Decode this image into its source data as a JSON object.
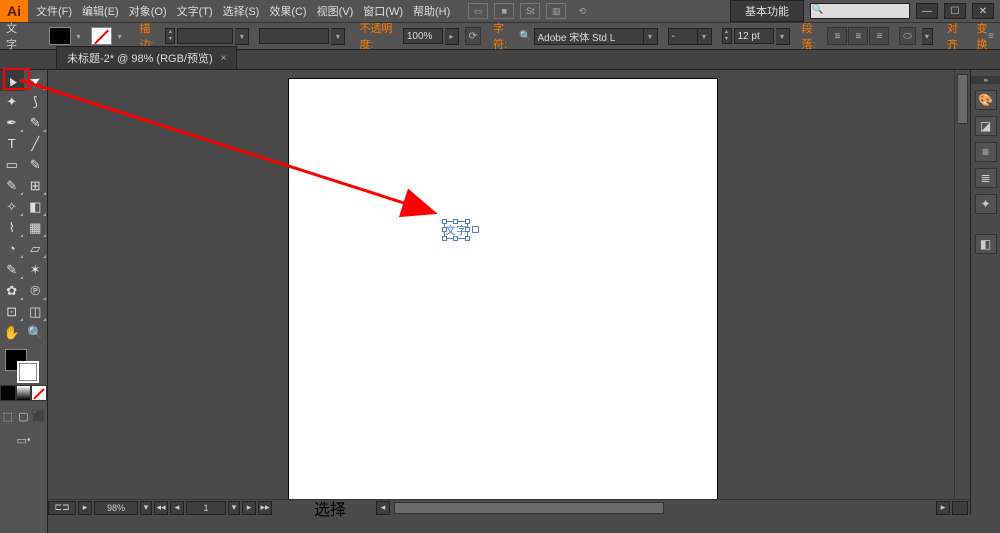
{
  "app": {
    "icon_text": "Ai"
  },
  "menu": {
    "file": "文件(F)",
    "edit": "编辑(E)",
    "object": "对象(O)",
    "type": "文字(T)",
    "select": "选择(S)",
    "effect": "效果(C)",
    "view": "视图(V)",
    "window": "窗口(W)",
    "help": "帮助(H)"
  },
  "menubar_icons": {
    "a": "▭",
    "b": "■",
    "c": "St",
    "d": "▥",
    "e": "⟲"
  },
  "workspace": {
    "label": "基本功能",
    "search_placeholder": ""
  },
  "window_controls": {
    "min": "—",
    "max": "☐",
    "close": "✕"
  },
  "control": {
    "tool_label": "文字",
    "stroke_label": "描边:",
    "stroke_value": "",
    "opacity_label": "不透明度:",
    "opacity_value": "100%",
    "recolor": "⟳",
    "char_label": "字符:",
    "font_value": "Adobe 宋体 Std L",
    "style_value": "-",
    "size_value": "12 pt",
    "para_label": "段落:",
    "align_btn": "对齐",
    "transform_btn": "变换"
  },
  "tab": {
    "title": "未标题-2* @ 98% (RGB/预览)",
    "close": "×"
  },
  "canvas": {
    "text_object": "文字"
  },
  "tools": {
    "row1a": "▲",
    "row1b": "▷",
    "row2a": "✥",
    "row2b": "❀",
    "row3a": "✒",
    "row3b": "✎",
    "row4a": "T",
    "row4b": "╱",
    "row5a": "▭",
    "row5b": "✎",
    "row6a": "⌒",
    "row6b": "⊞",
    "row7a": "✧",
    "row7b": "◧",
    "row8a": "⌇",
    "row8b": "▦",
    "row9a": "◔",
    "row9b": "▱",
    "row10a": "✎",
    "row10b": "✶",
    "row11a": "✿",
    "row11b": "℗",
    "row12a": "⊡",
    "row12b": "◫",
    "row13a": "✋",
    "row13b": "🔍"
  },
  "screen_modes": {
    "a": "⬚",
    "b": "▢",
    "c": "⬛"
  },
  "right_icons": {
    "color": "🎨",
    "swatch": "◪",
    "brush": "≡",
    "stroke": "≣",
    "sym": "✦",
    "layer": "◧"
  },
  "bottombar": {
    "artboard_nav_l": "◂◂",
    "artboard_nav_ll": "◂",
    "zoom": "98%",
    "page_nav_l": "◂◂",
    "page_nav_ll": "◂",
    "page": "1",
    "page_nav_r": "▸",
    "page_nav_rr": "▸▸"
  },
  "status": {
    "tool": "选择",
    "nav_l": "◂",
    "nav_r": "▸"
  },
  "collapse_chevron": "≡"
}
